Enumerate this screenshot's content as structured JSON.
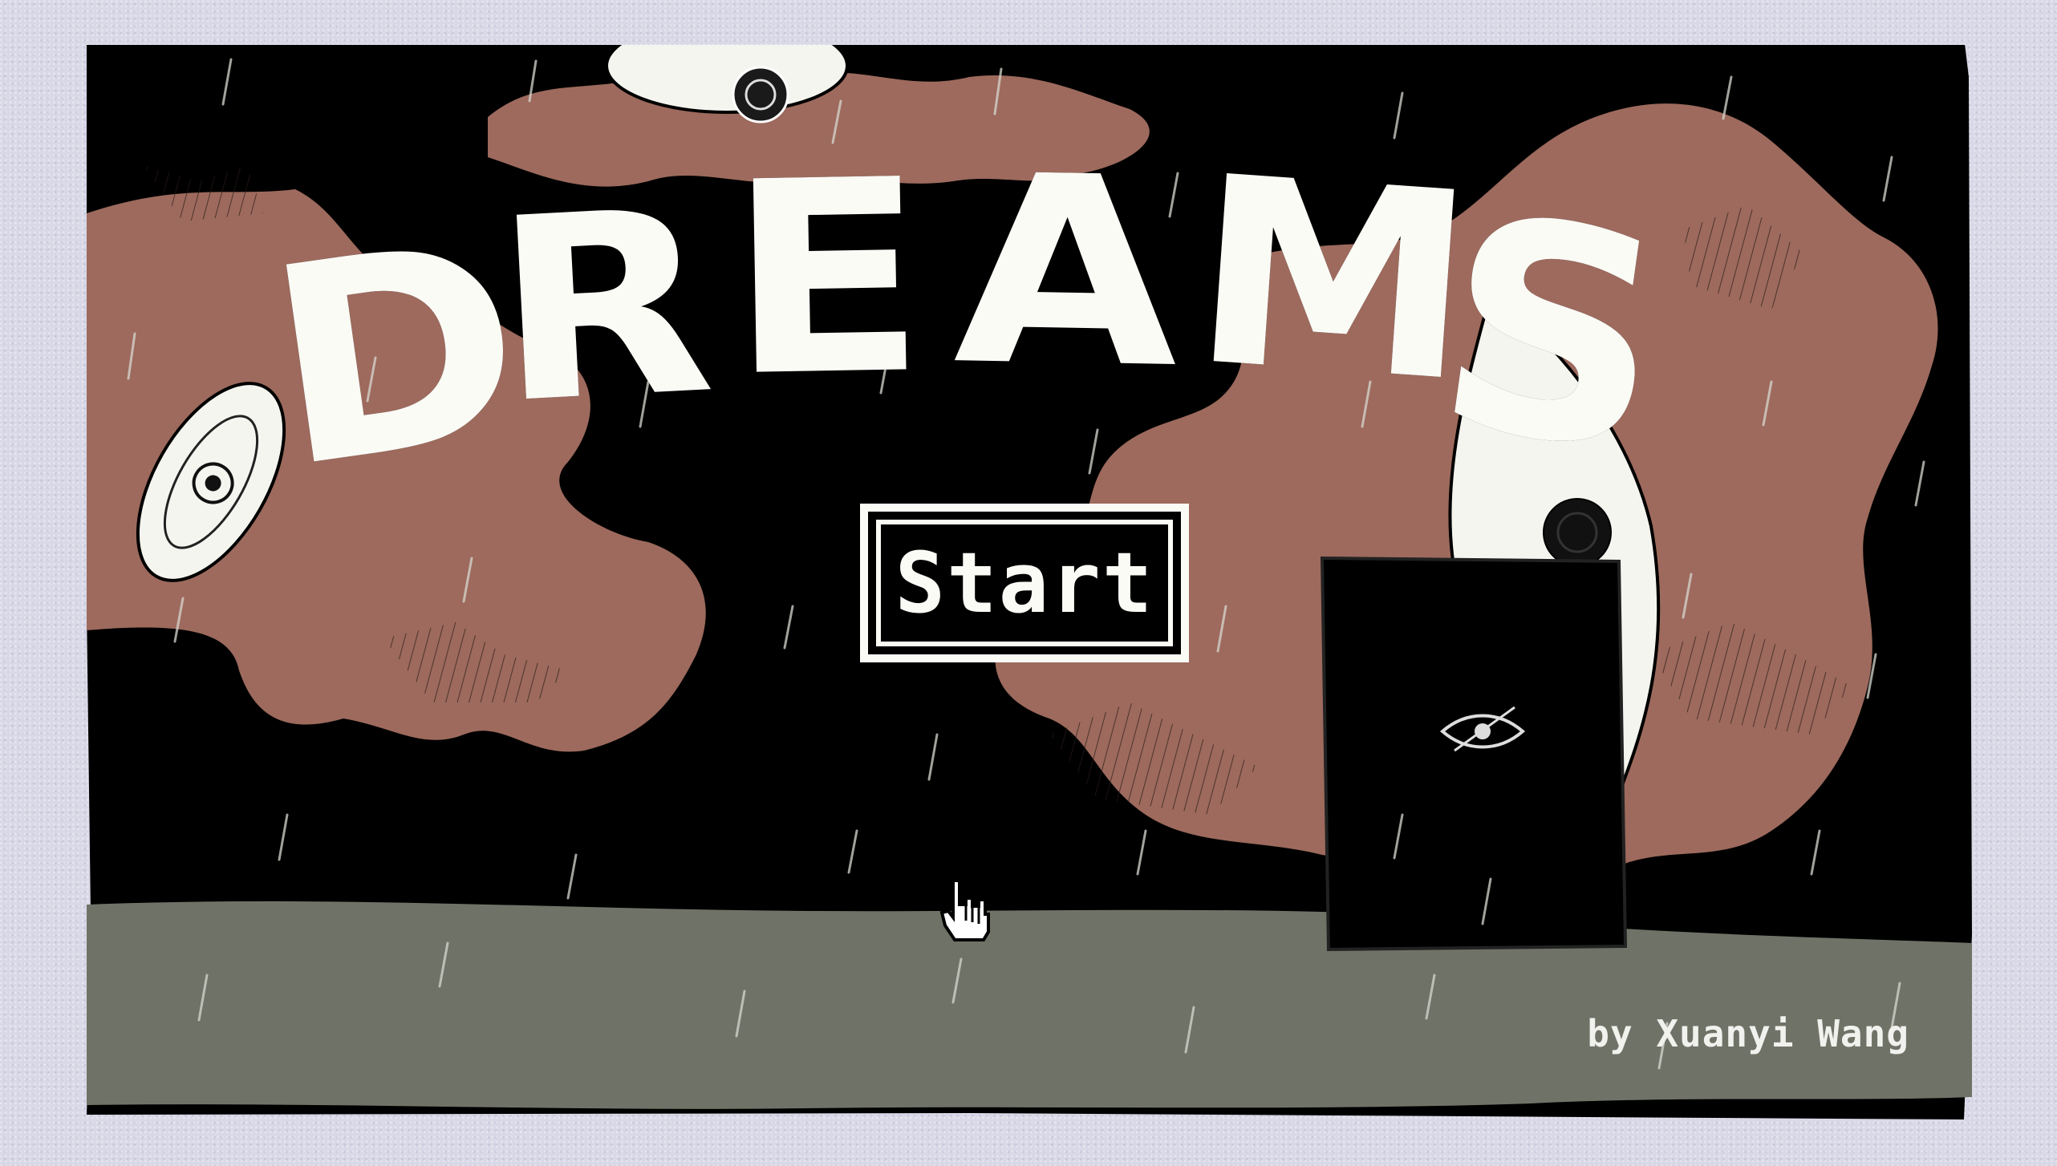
{
  "game": {
    "title_letters": [
      "D",
      "R",
      "E",
      "A",
      "M",
      "S"
    ],
    "start_label": "Start",
    "byline": "by Xuanyi Wang"
  },
  "colors": {
    "background": "#d8d8e7",
    "night_sky": "#000000",
    "clouds": "#9d6a5d",
    "ground": "#6f7367",
    "title": "#fbfbf6",
    "eye": "#f5f5f0"
  },
  "icons": {
    "cursor": "pointer-hand-icon",
    "eyes": [
      "top-eye-icon",
      "left-eye-icon",
      "right-eye-icon",
      "door-eye-icon"
    ]
  }
}
